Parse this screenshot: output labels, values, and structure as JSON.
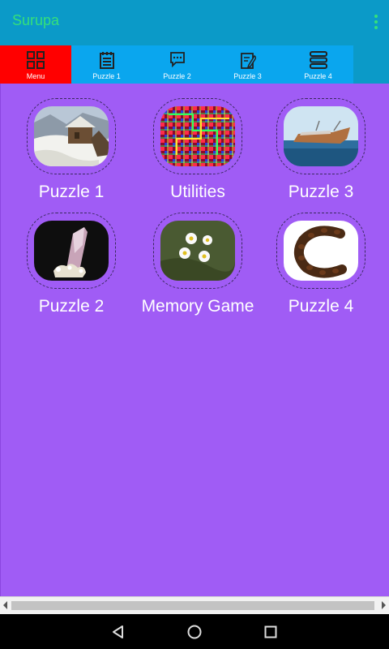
{
  "app": {
    "title": "Surupa"
  },
  "tabs": [
    {
      "label": "Menu",
      "icon": "grid-icon",
      "active": true
    },
    {
      "label": "Puzzle 1",
      "icon": "notepad-icon"
    },
    {
      "label": "Puzzle 2",
      "icon": "chat-icon"
    },
    {
      "label": "Puzzle 3",
      "icon": "edit-note-icon"
    },
    {
      "label": "Puzzle 4",
      "icon": "stack-icon"
    }
  ],
  "tiles": [
    {
      "label": "Puzzle 1",
      "image": "snowy-cabin-photo"
    },
    {
      "label": "Utilities",
      "image": "neon-pattern-photo"
    },
    {
      "label": "Puzzle 3",
      "image": "shipwreck-photo"
    },
    {
      "label": "Puzzle 2",
      "image": "crystal-photo"
    },
    {
      "label": "Memory Game",
      "image": "daisies-photo"
    },
    {
      "label": "Puzzle 4",
      "image": "coffee-beans-photo"
    }
  ],
  "colors": {
    "app_bar": "#0b9ac8",
    "title_text": "#35e07a",
    "tab_bar": "#0aa6ee",
    "active_tab": "#ff0000",
    "content_background": "#a05cf5"
  },
  "nav": {
    "back": "back-icon",
    "home": "home-icon",
    "recents": "recents-icon"
  }
}
